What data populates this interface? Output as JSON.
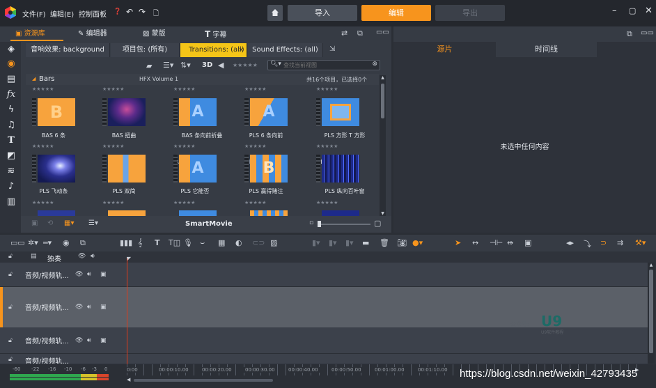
{
  "menu": {
    "file": "文件(F)",
    "edit": "编辑(E)",
    "control": "控制面板"
  },
  "nav": {
    "home_icon": "house-icon",
    "import": "导入",
    "edit": "编辑",
    "export": "导出"
  },
  "panel_tabs": {
    "library": "资源库",
    "editor": "编辑器",
    "mask": "蒙版",
    "title": "字幕"
  },
  "content_tabs": [
    {
      "label": "音响效果: background"
    },
    {
      "label": "项目包: (所有)"
    },
    {
      "label": "Transitions: (all)",
      "close": "×"
    },
    {
      "label": "Sound Effects: (all)"
    }
  ],
  "toolbar": {
    "mode_3d": "3D",
    "rating": "★★★★★",
    "search_placeholder": "查找当前视图"
  },
  "group": {
    "name": "Bars",
    "collection": "HFX Volume 1",
    "count": "共16个项目，已选择0个"
  },
  "items": [
    {
      "label": "BAS 6 条",
      "stars": "★★★★★"
    },
    {
      "label": "BAS 扭曲",
      "stars": "★★★★★"
    },
    {
      "label": "BAS 条向前折叠",
      "stars": "★★★★★"
    },
    {
      "label": "PLS 6 条向前",
      "stars": "★★★★★"
    },
    {
      "label": "PLS 方形 T 方形",
      "stars": "★★★★★"
    },
    {
      "label": "PLS 飞动条",
      "stars": "★★★★★"
    },
    {
      "label": "PLS 双简",
      "stars": "★★★★★"
    },
    {
      "label": "PLS 它能否",
      "stars": "★★★★★"
    },
    {
      "label": "PLS 赢得赌注",
      "stars": "★★★★★"
    },
    {
      "label": "PLS 纵向百叶窗",
      "stars": "★★★★★"
    }
  ],
  "bottom_bar": {
    "smartmovie": "SmartMovie"
  },
  "right_panel": {
    "tab_source": "源片",
    "tab_timeline": "时间线",
    "empty_message": "未选中任何内容"
  },
  "timeline": {
    "solo_label": "独奏",
    "tracks": [
      {
        "name": "音频/视频轨..."
      },
      {
        "name": "音频/视频轨..."
      },
      {
        "name": "音频/视频轨..."
      },
      {
        "name": "音频/视频轨..."
      }
    ],
    "ruler": [
      "0:00",
      "00:00:10.00",
      "00:00:20.00",
      "00:00:30.00",
      "00:00:40.00",
      "00:00:50.00",
      "00:01:00.00",
      "00:01:10.00"
    ],
    "meter": [
      "-60",
      "-22",
      "-16",
      "-10",
      "-6",
      "-3",
      "0"
    ]
  },
  "watermark": {
    "brand": "U9",
    "prefix": "公众号:",
    "sub": "U9软件教程"
  },
  "footer_url": "https://blog.csdn.net/weixin_42793435",
  "colors": {
    "accent": "#f7941d",
    "tab_active": "#f5c518",
    "playhead": "#e03c1c"
  }
}
